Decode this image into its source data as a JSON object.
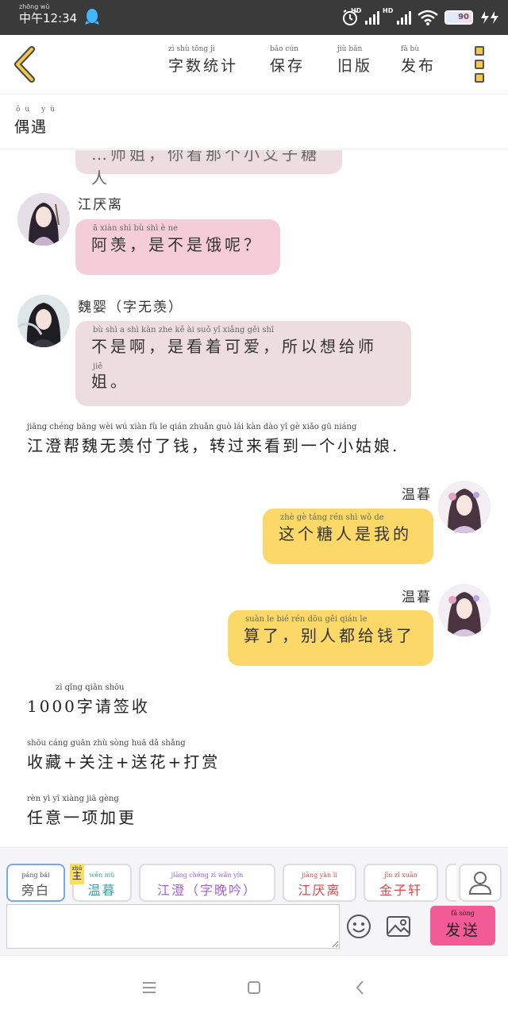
{
  "status_bar": {
    "time": "中午12:34",
    "time_pinyin": "zhōng wǔ",
    "network": "HD",
    "battery": "90"
  },
  "toolbar": {
    "word_count": "字数统计",
    "word_count_pinyin": "zì shù tǒng jì",
    "save": "保存",
    "save_pinyin": "bǎo cún",
    "old_version": "旧版",
    "old_version_pinyin": "jiù bǎn",
    "publish": "发布",
    "publish_pinyin": "fā bù"
  },
  "title": {
    "text": "偶遇",
    "pinyin": "ǒu yù"
  },
  "messages": {
    "partial_top": "…师姐，你看那个小艾子糖人",
    "m1_name": "江厌离",
    "m1_text": "阿羡，是不是饿呢？",
    "m1_pinyin": "ā  xiàn     shì  bù  shì  è   ne",
    "m2_name": "魏婴（字无羡）",
    "m2_text_line1": "不是啊，是看着可爱，所以想给师",
    "m2_text_line2": "姐。",
    "m2_pinyin1": "bù  shì   a       shì  kàn  zhe  kě   ài      suǒ  yǐ  xiǎng gěi  shī",
    "m2_pinyin2": "jiě",
    "narration1": "江澄帮魏无羡付了钱，转过来看到一个小姑娘.",
    "narration1_pinyin": "jiāng chéng bāng  wèi   wú  xiàn   fù    le   qián     zhuǎn guò   lái   kàn  dào   yī    gè   xiǎo  gū  niáng",
    "m3_name": "温暮",
    "m3_text": "这个糖人是我的",
    "m3_pinyin": "zhè   gè  táng  rén  shì  wǒ   de",
    "m4_name": "温暮",
    "m4_text": "算了，别人都给钱了",
    "m4_pinyin": "suàn  le        bié  rén  dōu  gěi  qián  le",
    "narration2": "1000字请签收",
    "narration2_pinyin": "zì  qǐng qiān shōu",
    "narration3": "收藏+关注+送花+打赏",
    "narration3_pinyin": "shōu cáng    guān  zhù    sòng  huā    dǎ  shǎng",
    "narration4": "任意一项加更",
    "narration4_pinyin": "rèn   yì   yī  xiàng  jiā  gèng"
  },
  "roles": [
    {
      "label": "旁白",
      "pinyin": "páng bái",
      "color": "#555555"
    },
    {
      "label": "温暮",
      "pinyin": "wēn  mù",
      "color": "#3aa7a7"
    },
    {
      "label": "江澄（字晚吟）",
      "pinyin": "jiāng chéng     zì  wǎn  yín",
      "color": "#a25fd6"
    },
    {
      "label": "江厌离",
      "pinyin": "jiāng yàn  lí",
      "color": "#e04848"
    },
    {
      "label": "金子轩",
      "pinyin": "jīn  zǐ  xuān",
      "color": "#e04848"
    }
  ],
  "owner_tag": {
    "label": "主",
    "pinyin": "zhǔ"
  },
  "input": {
    "placeholder": ""
  },
  "send": {
    "label": "发送",
    "pinyin": "fā  sòng"
  },
  "icons": {
    "back": "back-chevron-icon",
    "more": "more-menu-icon",
    "emoji": "emoji-icon",
    "image": "image-icon",
    "user": "user-icon"
  }
}
